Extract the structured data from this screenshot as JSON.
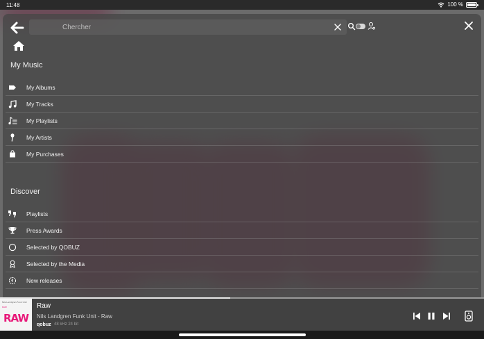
{
  "status_bar": {
    "time": "11:48",
    "battery": "100 %"
  },
  "search": {
    "placeholder": "Chercher",
    "value": ""
  },
  "my_music": {
    "title": "My Music",
    "items": [
      {
        "label": "My Albums",
        "icon": "album-tag-icon"
      },
      {
        "label": "My Tracks",
        "icon": "music-note-icon"
      },
      {
        "label": "My Playlists",
        "icon": "playlist-icon"
      },
      {
        "label": "My Artists",
        "icon": "microphone-icon"
      },
      {
        "label": "My Purchases",
        "icon": "shopping-bag-icon"
      }
    ]
  },
  "discover": {
    "title": "Discover",
    "items": [
      {
        "label": "Playlists",
        "icon": "quote-icon"
      },
      {
        "label": "Press Awards",
        "icon": "trophy-icon"
      },
      {
        "label": "Selected by QOBUZ",
        "icon": "circle-icon"
      },
      {
        "label": "Selected by the Media",
        "icon": "award-icon"
      },
      {
        "label": "New releases",
        "icon": "new-release-icon"
      }
    ]
  },
  "player": {
    "title": "Raw",
    "artist": "Nils Landgren Funk Unit - Raw",
    "source": "qobuz",
    "quality": "48 kHz 24 bit",
    "cover_top": "Nils Landgren Funk Unit",
    "cover_tag": "RAW",
    "cover_text": "RAW",
    "progress": 0.476
  },
  "colors": {
    "accent": "#e8197a",
    "background_art": "#6e2a45"
  }
}
